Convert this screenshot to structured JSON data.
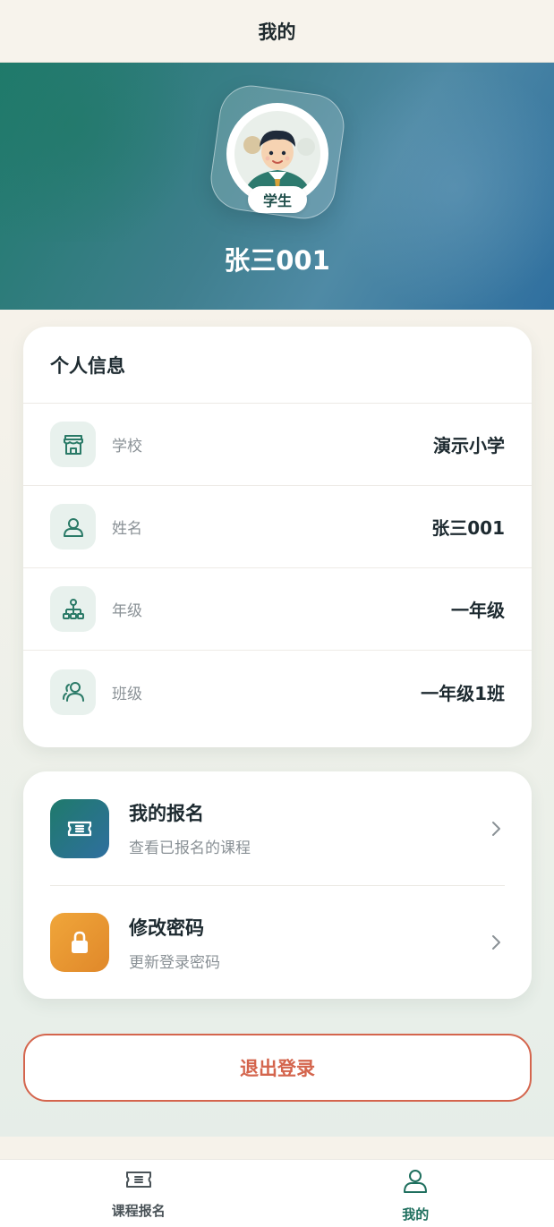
{
  "header": {
    "title": "我的"
  },
  "profile": {
    "role_badge": "学生",
    "name": "张三001"
  },
  "info_card": {
    "title": "个人信息",
    "rows": [
      {
        "icon": "school-store-icon",
        "label": "学校",
        "value": "演示小学"
      },
      {
        "icon": "person-icon",
        "label": "姓名",
        "value": "张三001"
      },
      {
        "icon": "hierarchy-icon",
        "label": "年级",
        "value": "一年级"
      },
      {
        "icon": "group-icon",
        "label": "班级",
        "value": "一年级1班"
      }
    ]
  },
  "menu": {
    "items": [
      {
        "icon": "ticket-icon",
        "title": "我的报名",
        "subtitle": "查看已报名的课程"
      },
      {
        "icon": "lock-icon",
        "title": "修改密码",
        "subtitle": "更新登录密码"
      }
    ]
  },
  "logout": {
    "label": "退出登录"
  },
  "tabbar": {
    "tabs": [
      {
        "icon": "ticket-icon",
        "label": "课程报名",
        "active": false
      },
      {
        "icon": "person-icon",
        "label": "我的",
        "active": true
      }
    ]
  },
  "colors": {
    "accent": "#1f6f5e",
    "danger": "#d4654d",
    "warning": "#f0a63a"
  }
}
